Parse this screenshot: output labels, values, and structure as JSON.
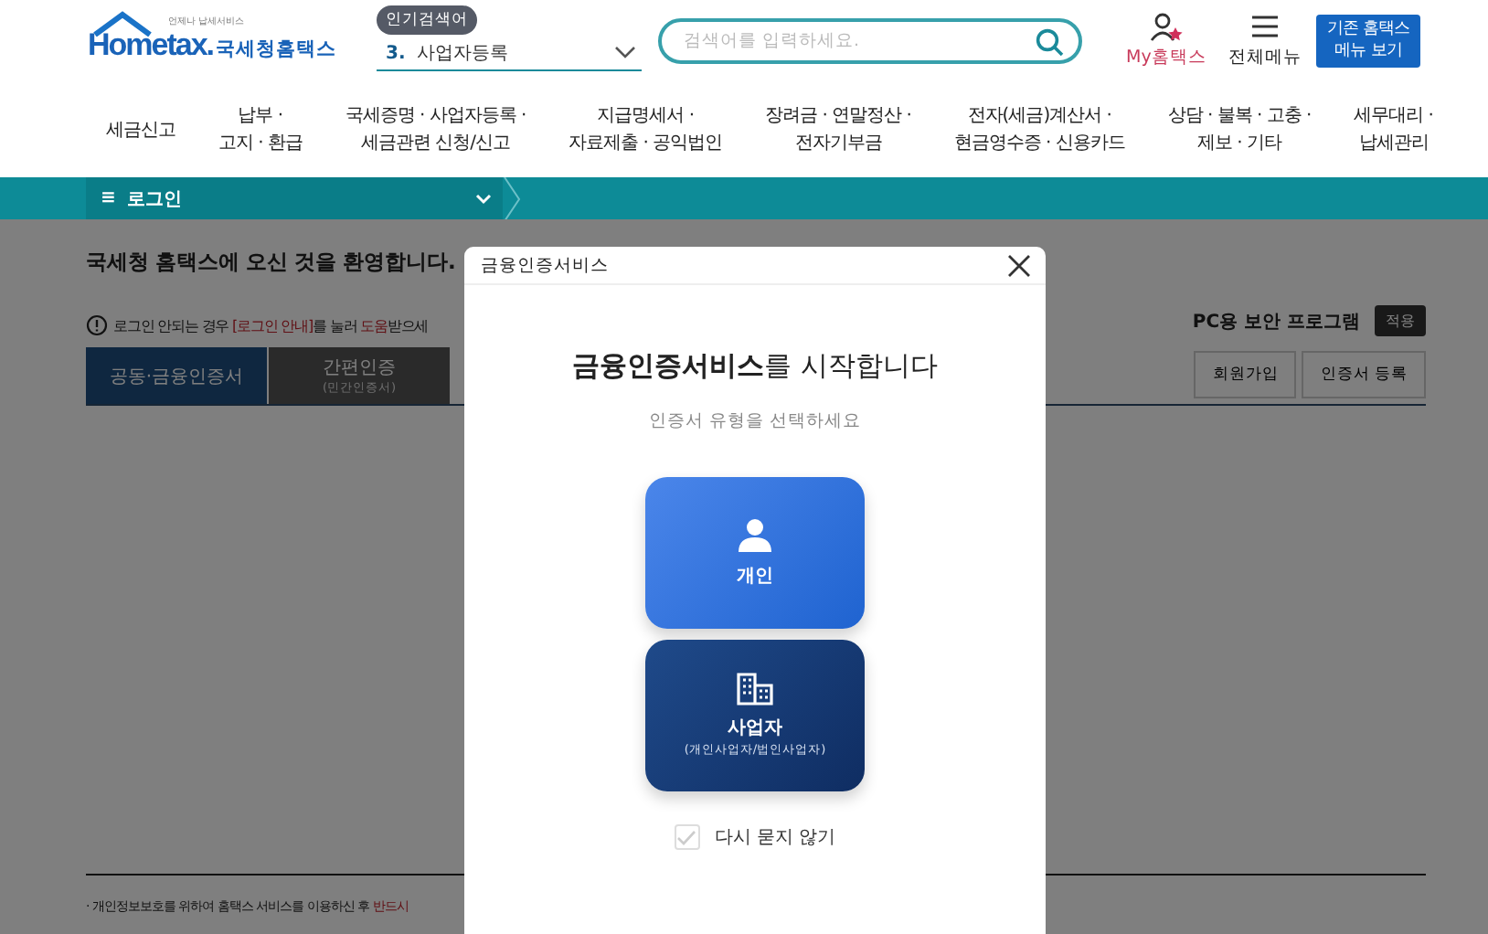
{
  "header": {
    "logo": {
      "tagline": "언제나 납세서비스",
      "wordmark": "Hometax.",
      "name": "국세청홈택스"
    },
    "popular": {
      "badge": "인기검색어",
      "rank": "3.",
      "term": "사업자등록"
    },
    "search": {
      "placeholder": "검색어를 입력하세요."
    },
    "my_link": "My홈택스",
    "menu_link": "전체메뉴",
    "classic_button": "기존 홈택스\n메뉴 보기"
  },
  "nav": [
    "세금신고",
    "납부 ·\n고지 · 환급",
    "국세증명 · 사업자등록 ·\n세금관련 신청/신고",
    "지급명세서 ·\n자료제출 · 공익법인",
    "장려금 · 연말정산 ·\n전자기부금",
    "전자(세금)계산서 ·\n현금영수증 · 신용카드",
    "상담 · 불복 · 고충 ·\n제보 · 기타",
    "세무대리 ·\n납세관리"
  ],
  "breadcrumb": {
    "menu_icon": "≡",
    "label": "로그인"
  },
  "login": {
    "welcome": "국세청 홈택스에 오신 것을 환영합니다.",
    "notice": [
      {
        "text": "로그인 안되는 경우 ",
        "highlight": false
      },
      {
        "text": "[로그인 안내]",
        "highlight": true
      },
      {
        "text": "를 눌러 ",
        "highlight": false
      },
      {
        "text": "도움",
        "highlight": true
      },
      {
        "text": "받으세",
        "highlight": false
      }
    ],
    "tabs": [
      {
        "label": "공동·금융인증서",
        "selected": true
      },
      {
        "label": "간편인증",
        "sub": "(민간인증서)",
        "selected": false
      }
    ],
    "security": {
      "label": "PC용 보안 프로그램",
      "button": "적용"
    },
    "buttons": [
      "회원가입",
      "인증서 등록"
    ],
    "footer_note": [
      {
        "text": "· 개인정보보호를 위하여 홈택스 서비스를 이용하신 후 ",
        "highlight": false
      },
      {
        "text": "반드시",
        "highlight": true
      }
    ]
  },
  "dialog": {
    "title": "금융인증서비스",
    "heading": "**금융인증서비스**를 시작합니다",
    "subtitle": "인증서 유형을 선택하세요",
    "options": [
      {
        "kind": "person",
        "label": "개인"
      },
      {
        "kind": "business",
        "label": "사업자",
        "sub": "(개인사업자/법인사업자)"
      }
    ],
    "dont_ask": {
      "label": "다시 묻지 않기",
      "checked": false
    }
  }
}
